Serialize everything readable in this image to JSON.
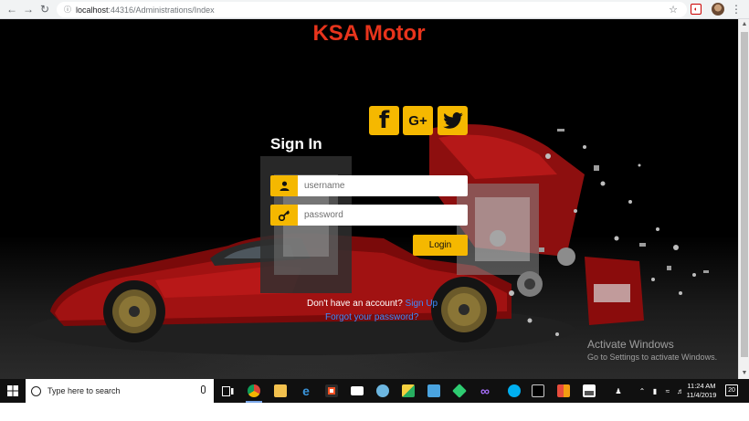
{
  "browser": {
    "url_host": "localhost",
    "url_path": ":44316/Administrations/Index",
    "back_icon": "arrow-left-icon",
    "forward_icon": "arrow-right-icon",
    "reload_icon": "reload-icon"
  },
  "page": {
    "brand": "KSA Motor",
    "brand_color": "#e8341c",
    "accent_color": "#f5b800",
    "social": [
      {
        "name": "facebook",
        "glyph": "f"
      },
      {
        "name": "google-plus",
        "glyph": "G+"
      },
      {
        "name": "twitter",
        "glyph": ""
      }
    ],
    "signin_title": "Sign In",
    "username_placeholder": "username",
    "password_placeholder": "password",
    "login_label": "Login",
    "no_account_text": "Don't have an account?",
    "signup_link": "Sign Up",
    "forgot_link": "Forgot your password?"
  },
  "watermark": {
    "line1": "Activate Windows",
    "line2": "Go to Settings to activate Windows."
  },
  "taskbar": {
    "search_placeholder": "Type here to search",
    "time": "11:24 AM",
    "date": "11/4/2019",
    "notification_count": "20"
  }
}
